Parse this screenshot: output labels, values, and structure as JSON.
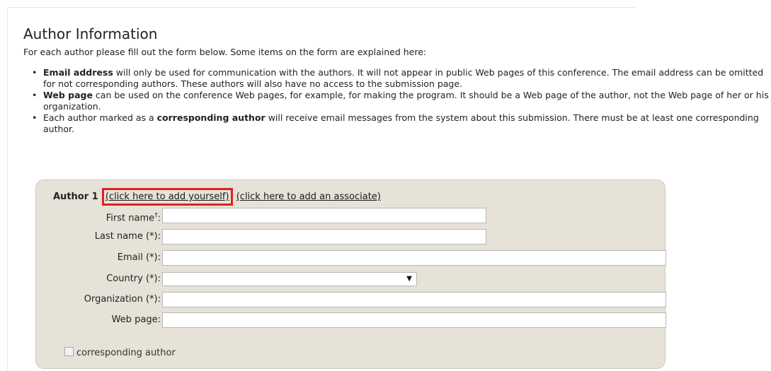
{
  "heading": "Author Information",
  "intro": "For each author please fill out the form below. Some items on the form are explained here:",
  "notes": [
    {
      "bold": "Email address",
      "text": " will only be used for communication with the authors. It will not appear in public Web pages of this conference. The email address can be omitted for not corresponding authors. These authors will also have no access to the submission page."
    },
    {
      "bold": "Web page",
      "text": " can be used on the conference Web pages, for example, for making the program. It should be a Web page of the author, not the Web page of her or his organization."
    },
    {
      "pre": "Each author marked as a ",
      "bold": "corresponding author",
      "text": " will receive email messages from the system about this submission. There must be at least one corresponding author."
    }
  ],
  "author_block": {
    "title": "Author 1",
    "add_yourself": "(click here to add yourself)",
    "add_associate": "(click here to add an associate)",
    "first_name_label": "First name",
    "first_name_mark": "†",
    "first_name_colon": ":",
    "last_name_label": "Last name (*):",
    "email_label": "Email (*):",
    "country_label": "Country (*):",
    "organization_label": "Organization (*):",
    "web_page_label": "Web page:",
    "corresponding_label": "corresponding author",
    "country_value": "",
    "first_name_value": "",
    "last_name_value": "",
    "email_value": "",
    "organization_value": "",
    "web_page_value": ""
  },
  "icons": {
    "dropdown": "chevron-down-icon",
    "bullet": "bullet-icon"
  },
  "colors": {
    "panel_bg": "#e6e2d8",
    "highlight": "#e02020"
  }
}
